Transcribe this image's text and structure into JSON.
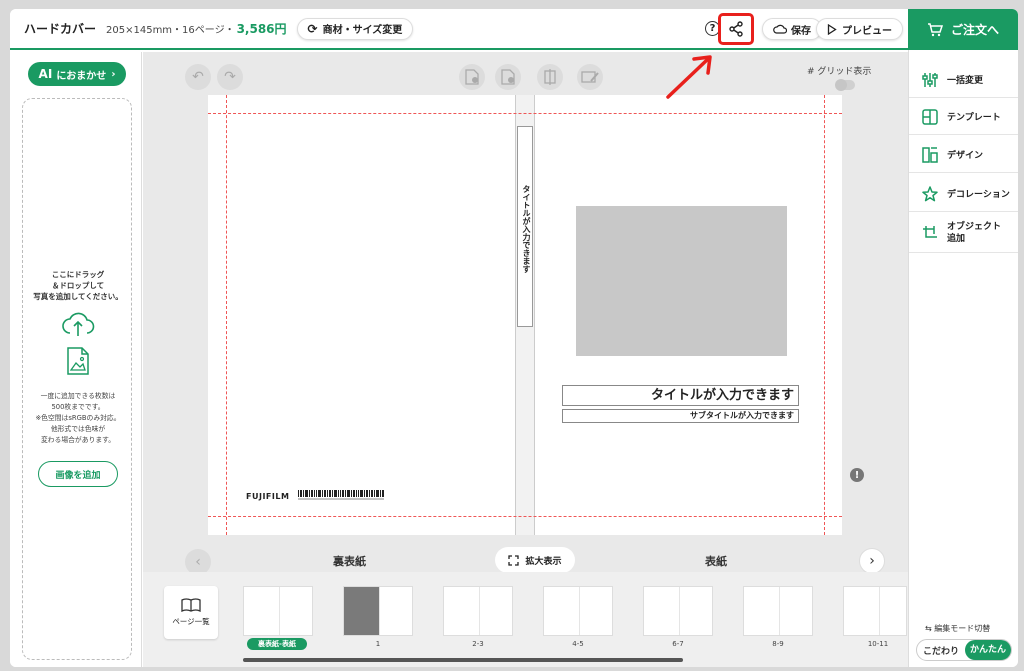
{
  "header": {
    "product_title": "ハードカバー",
    "product_spec": "205×145mm・16ページ・",
    "product_price": "3,586円",
    "change_button": "商材・サイズ変更",
    "help_label": "?",
    "save_button": "保存",
    "preview_button": "プレビュー",
    "order_button": "ご注文へ"
  },
  "left_panel": {
    "ai_button": "におまかせ",
    "ai_prefix": "AI",
    "drop_line1": "ここにドラッグ",
    "drop_line2": "＆ドロップして",
    "drop_line3": "写真を追加してください。",
    "info_line1": "一度に追加できる枚数は",
    "info_line2": "500枚までです。",
    "info_line3": "※色空間はsRGBのみ対応。",
    "info_line4": "他形式では色味が",
    "info_line5": "変わる場合があります。",
    "add_image_button": "画像を追加"
  },
  "canvas": {
    "grid_label": "グリッド表示",
    "grid_on": false,
    "spine_title": "タイトルが入力できます",
    "cover_title": "タイトルが入力できます",
    "cover_subtitle": "サブタイトルが入力できます",
    "brand": "FUJIFILM",
    "back_cover_label": "裏表紙",
    "front_cover_label": "表紙",
    "zoom_button": "拡大表示",
    "alert_label": "!"
  },
  "thumbnails": {
    "page_list_button": "ページ一覧",
    "badge": "裏表紙-表紙",
    "items": [
      "1",
      "2-3",
      "4-5",
      "6-7",
      "8-9",
      "10-11"
    ]
  },
  "right_panel": {
    "items": [
      {
        "label": "一括変更",
        "icon": "sliders-icon"
      },
      {
        "label": "テンプレート",
        "icon": "layout-icon"
      },
      {
        "label": "デザイン",
        "icon": "design-icon"
      },
      {
        "label": "デコレーション",
        "icon": "star-icon"
      },
      {
        "label_line1": "オブジェクト",
        "label_line2": "追加",
        "icon": "add-object-icon"
      }
    ],
    "mode_label": "編集モード切替",
    "mode_off": "こだわり",
    "mode_on": "かんたん"
  },
  "colors": {
    "accent": "#1a9a62",
    "highlight": "#e8201c",
    "bleed": "#ef5656"
  }
}
